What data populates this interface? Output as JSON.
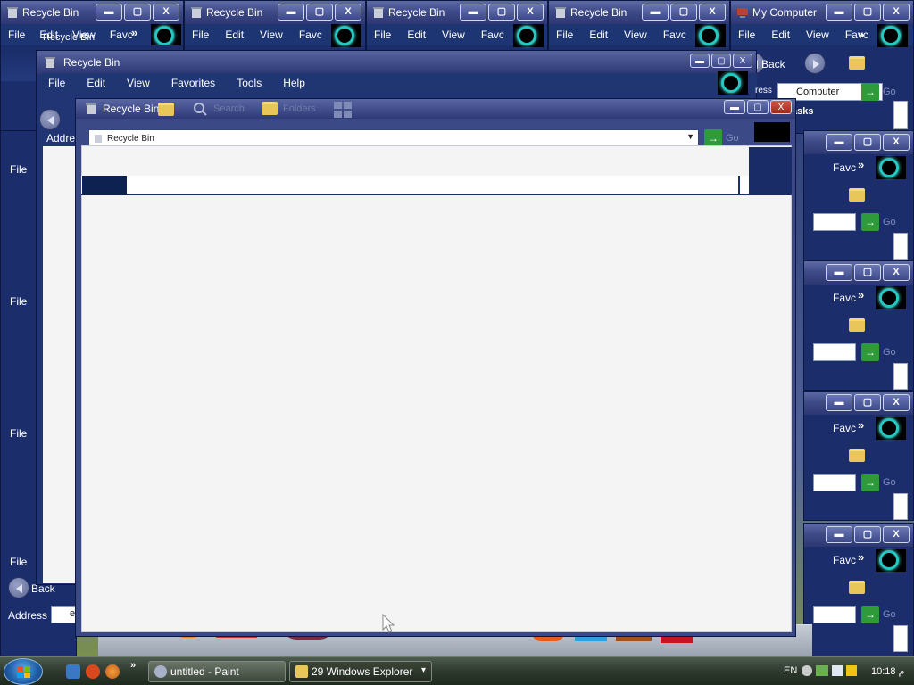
{
  "colors": {
    "titlebar": "#2c3773",
    "accent_ring": "#25c7c1",
    "content_bg": "#f4f4f4",
    "taskbar": "#2f3a2e"
  },
  "top_windows": [
    {
      "title": "Recycle Bin",
      "icon": "recycle-bin-icon"
    },
    {
      "title": "Recycle Bin",
      "icon": "recycle-bin-icon"
    },
    {
      "title": "Recycle Bin",
      "icon": "recycle-bin-icon"
    },
    {
      "title": "Recycle Bin",
      "icon": "recycle-bin-icon"
    },
    {
      "title": "My Computer",
      "icon": "my-computer-icon"
    }
  ],
  "window_controls": {
    "minimize": "▬",
    "maximize": "▢",
    "close": "X"
  },
  "menu": {
    "file": "File",
    "edit": "Edit",
    "view": "View",
    "favorites": "Favorites",
    "favorites_cut": "Favc",
    "tools": "Tools",
    "help": "Help",
    "more": "»"
  },
  "overlap": {
    "title_recycle": "Recycle Bin",
    "back": "Back",
    "address": "Address",
    "computer": "Computer",
    "tasks": "asks",
    "go": "Go",
    "ress": "ress",
    "fragment_e": "e"
  },
  "mid_window": {
    "title": "Recycle Bin",
    "title_offset": "Recycle Bin",
    "fragment_fil": "Fil",
    "fragment_edit": "Edit",
    "fragment_view": "View"
  },
  "front_window": {
    "title": "Recycle Bin",
    "toolbar": {
      "search": "Search",
      "folders": "Folders"
    },
    "address_label": "Address",
    "address_value": "Recycle Bin",
    "go": "Go"
  },
  "taskbar": {
    "buttons": [
      {
        "label": "untitled - Paint"
      },
      {
        "label": "29 Windows Explorer",
        "dropdown": "▾"
      }
    ],
    "language": "EN",
    "clock": "10:18 ‫م"
  }
}
